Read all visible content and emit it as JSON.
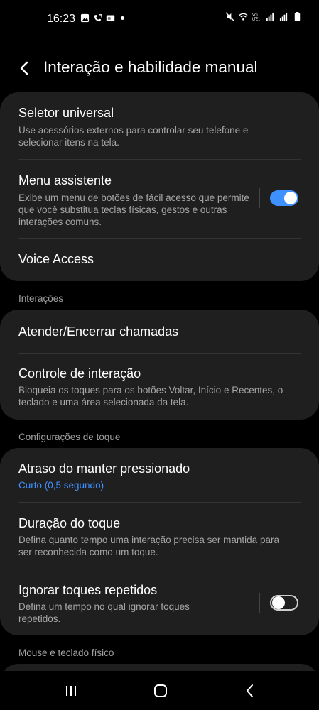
{
  "status_bar": {
    "time": "16:23"
  },
  "header": {
    "title": "Interação e habilidade manual"
  },
  "group1": {
    "universal_switch": {
      "title": "Seletor universal",
      "desc": "Use acessórios externos para controlar seu telefone e selecionar itens na tela."
    },
    "assistant_menu": {
      "title": "Menu assistente",
      "desc": "Exibe um menu de botões de fácil acesso que permite que você substitua teclas físicas, gestos e outras interações comuns.",
      "enabled": true
    },
    "voice_access": {
      "title": "Voice Access"
    }
  },
  "section_interactions": {
    "label": "Interações"
  },
  "group2": {
    "answer_end_calls": {
      "title": "Atender/Encerrar chamadas"
    },
    "interaction_control": {
      "title": "Controle de interação",
      "desc": "Bloqueia os toques para os botões Voltar, Início e Recentes, o teclado e uma área selecionada da tela."
    }
  },
  "section_touch": {
    "label": "Configurações de toque"
  },
  "group3": {
    "touch_hold_delay": {
      "title": "Atraso do manter pressionado",
      "value": "Curto (0,5 segundo)"
    },
    "tap_duration": {
      "title": "Duração do toque",
      "desc": "Defina quanto tempo uma interação precisa ser mantida para ser reconhecida como um toque."
    },
    "ignore_repeated": {
      "title": "Ignorar toques repetidos",
      "desc": "Defina um tempo no qual ignorar toques repetidos.",
      "enabled": false
    }
  },
  "section_mouse": {
    "label": "Mouse e teclado físico"
  },
  "colors": {
    "accent": "#3e91ff",
    "card": "#1f1f1f",
    "background": "#000000"
  }
}
